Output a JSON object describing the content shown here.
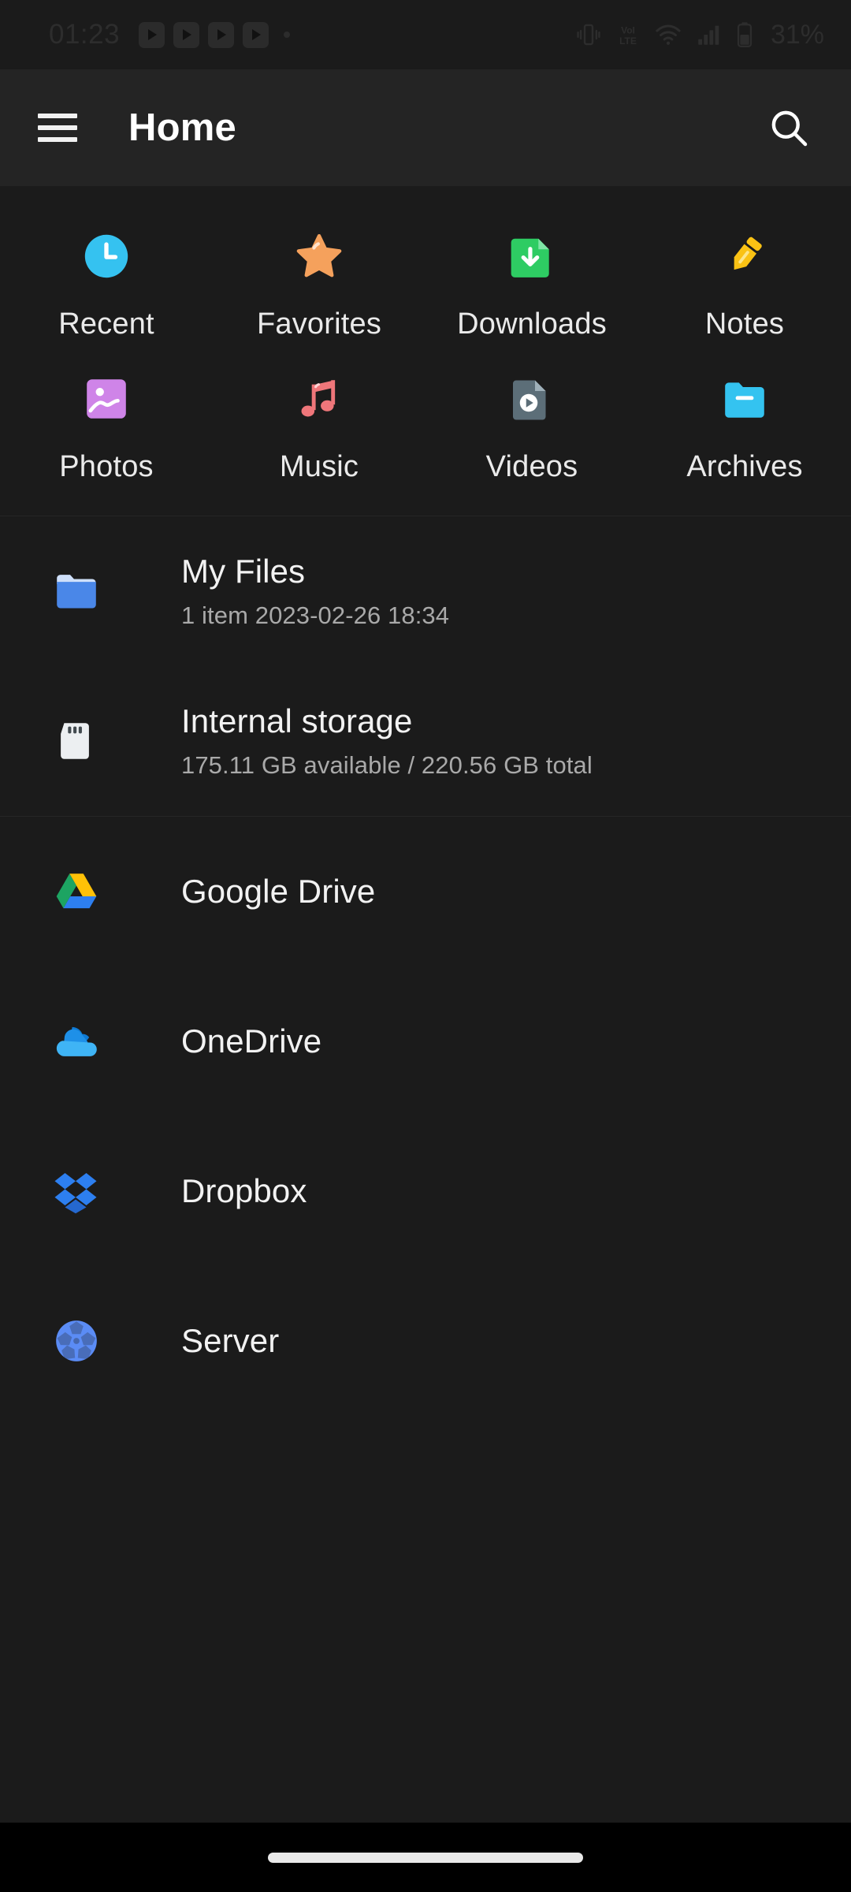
{
  "status_bar": {
    "clock": "01:23",
    "battery_text": "31%",
    "icons": [
      "youtube-notification",
      "youtube-notification",
      "youtube-notification",
      "youtube-notification",
      "more-notifications-dot",
      "vibrate-icon",
      "volte-icon",
      "wifi-icon",
      "signal-icon",
      "battery-icon"
    ]
  },
  "app_bar": {
    "menu_icon": "hamburger-menu-icon",
    "title": "Home",
    "search_icon": "search-icon"
  },
  "shortcuts": {
    "row1": [
      {
        "label": "Recent",
        "icon": "clock-icon",
        "color": "#35c2f0"
      },
      {
        "label": "Favorites",
        "icon": "star-icon",
        "color": "#f5a15c"
      },
      {
        "label": "Downloads",
        "icon": "download-file-icon",
        "color": "#2ecc63"
      },
      {
        "label": "Notes",
        "icon": "pencil-icon",
        "color": "#fac214"
      }
    ],
    "row2": [
      {
        "label": "Photos",
        "icon": "image-icon",
        "color": "#cf84e8"
      },
      {
        "label": "Music",
        "icon": "music-note-icon",
        "color": "#ef767a"
      },
      {
        "label": "Videos",
        "icon": "video-file-icon",
        "color": "#5c6e78"
      },
      {
        "label": "Archives",
        "icon": "folder-zip-icon",
        "color": "#34c3f0"
      }
    ]
  },
  "storage_list": [
    {
      "title": "My Files",
      "subtitle": "1 item 2023-02-26 18:34",
      "icon": "blue-folder-icon",
      "color": "#4a87e8"
    },
    {
      "title": "Internal storage",
      "subtitle": "175.11 GB available / 220.56 GB total",
      "icon": "sd-card-icon",
      "color": "#eceff1"
    }
  ],
  "cloud_list": [
    {
      "title": "Google Drive",
      "icon": "google-drive-icon",
      "color": "#ffc107"
    },
    {
      "title": "OneDrive",
      "icon": "onedrive-icon",
      "color": "#1e90e8"
    },
    {
      "title": "Dropbox",
      "icon": "dropbox-icon",
      "color": "#2d7ff0"
    },
    {
      "title": "Server",
      "icon": "server-globe-icon",
      "color": "#5b8cf5"
    }
  ],
  "nav_bar": {
    "gesture_handle": "home-gesture-pill"
  }
}
